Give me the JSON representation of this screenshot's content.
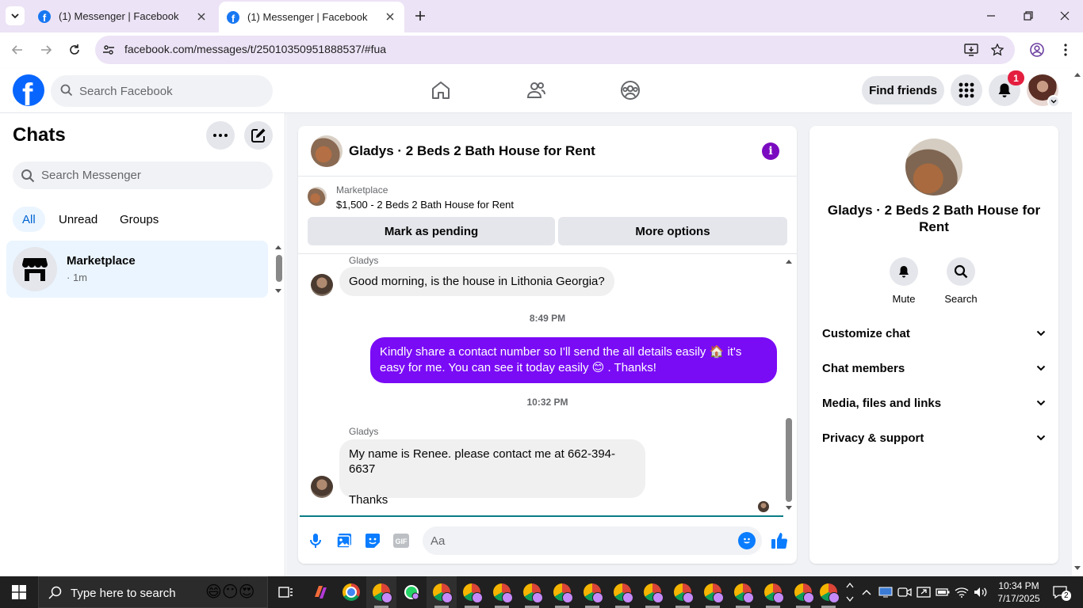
{
  "browser": {
    "tabs": [
      {
        "title": "(1) Messenger | Facebook"
      },
      {
        "title": "(1) Messenger | Facebook"
      }
    ],
    "url": "facebook.com/messages/t/25010350951888537/#fua"
  },
  "header": {
    "search_placeholder": "Search Facebook",
    "find_friends": "Find friends",
    "notification_count": "1"
  },
  "sidebar": {
    "title": "Chats",
    "search_placeholder": "Search Messenger",
    "filters": [
      "All",
      "Unread",
      "Groups"
    ],
    "chat": {
      "name": "Marketplace",
      "time": "· 1m"
    }
  },
  "conversation": {
    "title": "Gladys · 2 Beds 2 Bath House for Rent",
    "listing": {
      "source": "Marketplace",
      "description": "$1,500 - 2 Beds 2 Bath House for Rent",
      "mark_pending": "Mark as pending",
      "more_options": "More options"
    },
    "messages": {
      "sender1": "Gladys",
      "msg1": "Good morning, is the house in Lithonia Georgia?",
      "time1": "8:49 PM",
      "out_part1": "Kindly share a contact number so I'll send the all details easily",
      "out_part2": "it's easy",
      "out_part3": "for me. You can see it today easily",
      "out_part4": ". Thanks!",
      "time2": "10:32 PM",
      "sender2": "Gladys",
      "msg2_line1": "My name is Renee. please contact me at 662-394-6637",
      "msg2_line2": "Thanks"
    },
    "composer_placeholder": "Aa"
  },
  "info_panel": {
    "name": "Gladys · 2 Beds 2 Bath House for Rent",
    "mute": "Mute",
    "search": "Search",
    "sections": [
      "Customize chat",
      "Chat members",
      "Media, files and links",
      "Privacy & support"
    ]
  },
  "taskbar": {
    "search_placeholder": "Type here to search",
    "time": "10:34 PM",
    "date": "7/17/2025",
    "notifications": "2"
  },
  "colors": {
    "accent": "#7a0bf5",
    "facebook_blue": "#0866ff",
    "selected_chat": "#ebf5ff"
  }
}
